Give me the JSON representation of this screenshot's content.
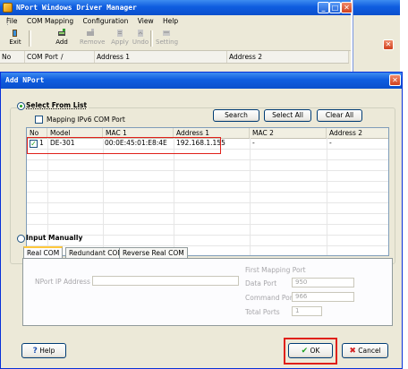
{
  "main_window": {
    "title": "NPort Windows Driver Manager",
    "menu": [
      "File",
      "COM Mapping",
      "Configuration",
      "View",
      "Help"
    ],
    "toolbar": [
      {
        "label": "Exit",
        "icon": "exit-icon",
        "enabled": true
      },
      {
        "label": "Add",
        "icon": "add-icon",
        "enabled": true
      },
      {
        "label": "Remove",
        "icon": "remove-icon",
        "enabled": false
      },
      {
        "label": "Apply",
        "icon": "apply-icon",
        "enabled": false
      },
      {
        "label": "Undo",
        "icon": "undo-icon",
        "enabled": false
      },
      {
        "label": "Setting",
        "icon": "setting-icon",
        "enabled": false
      }
    ],
    "columns": [
      "No",
      "COM Port",
      "Address 1",
      "Address 2"
    ]
  },
  "dialog": {
    "title": "Add NPort",
    "select_from_list": {
      "label": "Select From List",
      "selected": true,
      "ipv6_checkbox": {
        "label": "Mapping IPv6 COM Port",
        "checked": false
      },
      "buttons": {
        "search": "Search",
        "select_all": "Select All",
        "clear_all": "Clear All"
      },
      "columns": [
        "No",
        "Model",
        "MAC 1",
        "Address 1",
        "MAC 2",
        "Address 2"
      ],
      "rows": [
        {
          "checked": true,
          "no": "1",
          "model": "DE-301",
          "mac1": "00:0E:45:01:E8:4E",
          "address1": "192.168.1.155",
          "mac2": "-",
          "address2": "-"
        }
      ]
    },
    "input_manually": {
      "label": "Input Manually",
      "selected": false,
      "tabs": [
        "Real COM",
        "Redundant COM",
        "Reverse Real COM"
      ],
      "active_tab": "Real COM",
      "nport_ip_label": "NPort IP Address",
      "nport_ip_value": "",
      "first_mapping_port_label": "First Mapping Port",
      "data_port_label": "Data Port",
      "data_port_value": "950",
      "command_port_label": "Command Port",
      "command_port_value": "966",
      "total_ports_label": "Total Ports",
      "total_ports_value": "1"
    },
    "buttons": {
      "help": "Help",
      "ok": "OK",
      "cancel": "Cancel"
    }
  },
  "colors": {
    "titlebar": "#0f5de0",
    "highlight": "#e0201a",
    "ok_check": "#21a121",
    "cancel_x": "#d42323"
  }
}
